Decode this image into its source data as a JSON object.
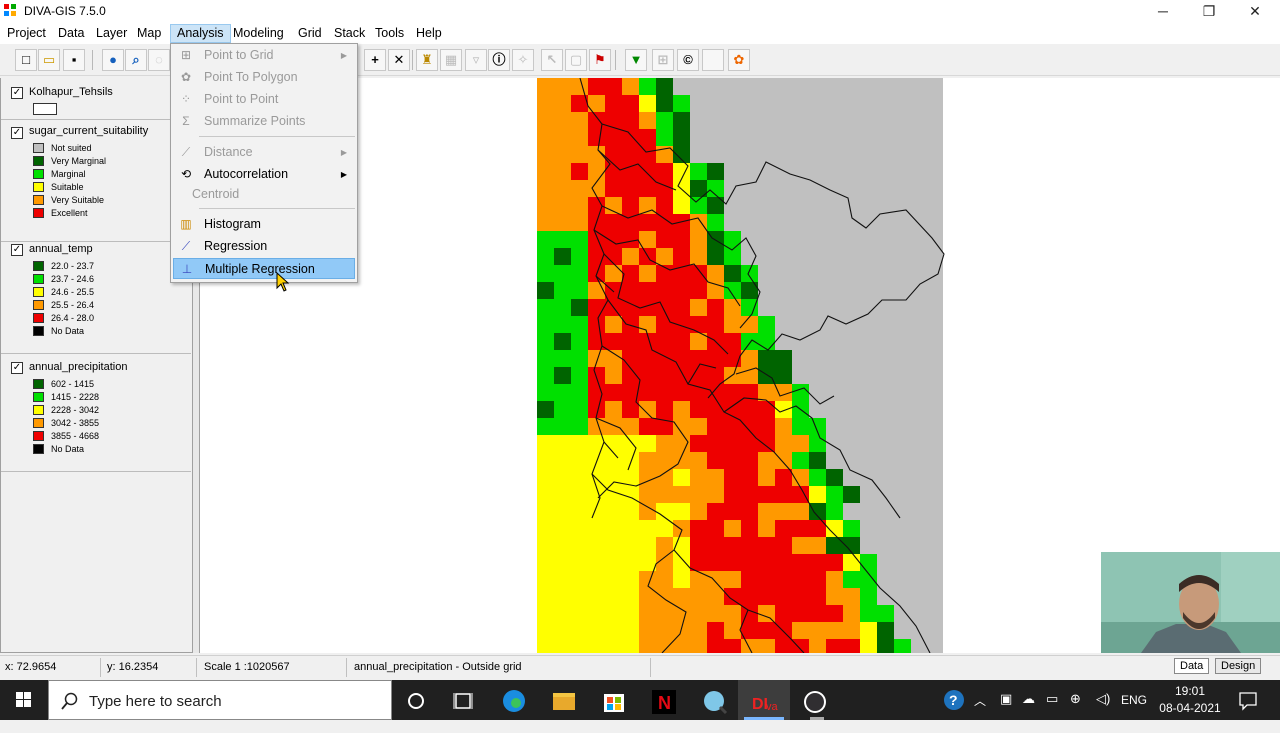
{
  "window": {
    "title": "DIVA-GIS 7.5.0",
    "controls": [
      "─",
      "❐",
      "✕"
    ]
  },
  "menubar": {
    "items": [
      "Project",
      "Data",
      "Layer",
      "Map",
      "Analysis",
      "Modeling",
      "Grid",
      "Stack",
      "Tools",
      "Help"
    ],
    "active": "Analysis"
  },
  "analysis_menu": {
    "items": [
      {
        "label": "Point to Grid",
        "disabled": true,
        "submenu": true,
        "icon": "grid-icon"
      },
      {
        "label": "Point To Polygon",
        "disabled": true,
        "submenu": false,
        "icon": "polygon-icon"
      },
      {
        "label": "Point to Point",
        "disabled": true,
        "submenu": false,
        "icon": "points-icon"
      },
      {
        "label": "Summarize Points",
        "disabled": true,
        "submenu": false,
        "icon": "summarize-icon"
      },
      {
        "label": "Distance",
        "disabled": true,
        "submenu": true,
        "icon": "distance-icon"
      },
      {
        "label": "Autocorrelation",
        "disabled": false,
        "submenu": true,
        "icon": "autocorrelation-icon"
      },
      {
        "label": "Centroid",
        "disabled": true,
        "submenu": false,
        "icon": ""
      },
      {
        "label": "Histogram",
        "disabled": false,
        "submenu": false,
        "icon": "histogram-icon"
      },
      {
        "label": "Regression",
        "disabled": false,
        "submenu": false,
        "icon": "regression-icon"
      },
      {
        "label": "Multiple Regression",
        "disabled": false,
        "submenu": false,
        "icon": "multiple-regression-icon",
        "highlighted": true
      }
    ]
  },
  "legend": {
    "layers": [
      {
        "name": "Kolhapur_Tehsils",
        "checked": true,
        "classes": []
      },
      {
        "name": "sugar_current_suitability",
        "checked": true,
        "classes": [
          {
            "label": "Not suited",
            "color": "#c0c0c0"
          },
          {
            "label": "Very Marginal",
            "color": "#006400"
          },
          {
            "label": "Marginal",
            "color": "#00e000"
          },
          {
            "label": "Suitable",
            "color": "#ffff00"
          },
          {
            "label": "Very Suitable",
            "color": "#ff9900"
          },
          {
            "label": "Excellent",
            "color": "#ee0000"
          }
        ]
      },
      {
        "name": "annual_temp",
        "checked": true,
        "classes": [
          {
            "label": "22.0 - 23.7",
            "color": "#006400"
          },
          {
            "label": "23.7 - 24.6",
            "color": "#00e000"
          },
          {
            "label": "24.6 - 25.5",
            "color": "#ffff00"
          },
          {
            "label": "25.5 - 26.4",
            "color": "#ff9900"
          },
          {
            "label": "26.4 - 28.0",
            "color": "#ee0000"
          },
          {
            "label": "No Data",
            "color": "#000000"
          }
        ]
      },
      {
        "name": "annual_precipitation",
        "checked": true,
        "classes": [
          {
            "label": "602 - 1415",
            "color": "#006400"
          },
          {
            "label": "1415 - 2228",
            "color": "#00e000"
          },
          {
            "label": "2228 - 3042",
            "color": "#ffff00"
          },
          {
            "label": "3042 - 3855",
            "color": "#ff9900"
          },
          {
            "label": "3855 - 4668",
            "color": "#ee0000"
          },
          {
            "label": "No Data",
            "color": "#000000"
          }
        ]
      }
    ]
  },
  "status": {
    "x": "x: 72.9654",
    "y": "y: 16.2354",
    "scale": "Scale 1 :1020567",
    "info": "annual_precipitation - Outside grid",
    "tabs": [
      "Data",
      "Design"
    ]
  },
  "taskbar": {
    "search_placeholder": "Type here to search",
    "lang": "ENG",
    "time": "19:01",
    "date": "08-04-2021"
  },
  "colors": {
    "grey": "#c0c0c0",
    "dark_green": "#006400",
    "green": "#00e000",
    "yellow": "#ffff00",
    "orange": "#ff9900",
    "red": "#ee0000"
  }
}
